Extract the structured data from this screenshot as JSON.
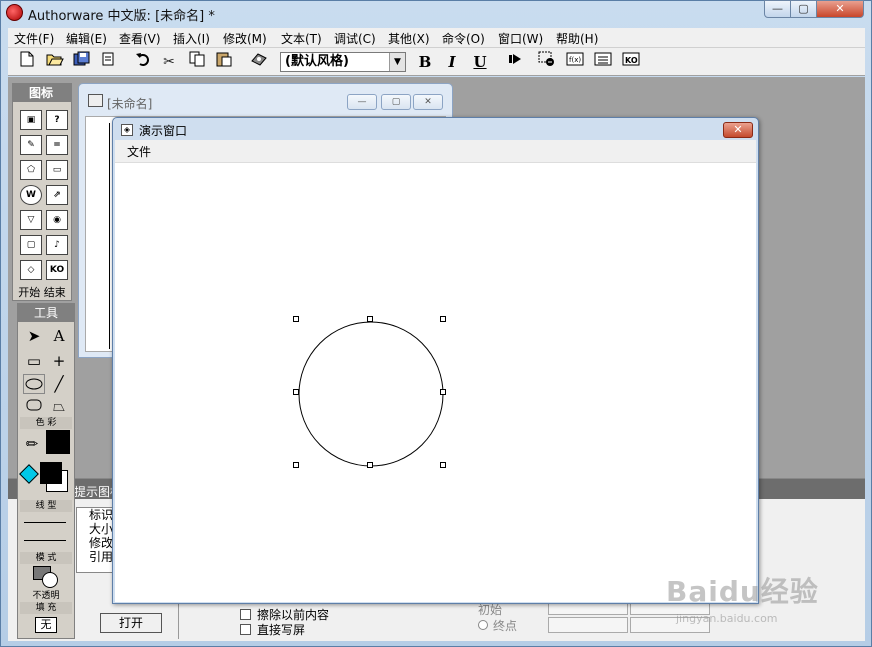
{
  "window": {
    "title": "Authorware 中文版: [未命名] *",
    "min_glyph": "—",
    "max_glyph": "▢",
    "close_glyph": "✕"
  },
  "menubar": {
    "items": [
      "文件(F)",
      "编辑(E)",
      "查看(V)",
      "插入(I)",
      "修改(M)",
      "文本(T)",
      "调试(C)",
      "其他(X)",
      "命令(O)",
      "窗口(W)",
      "帮助(H)"
    ]
  },
  "toolbar": {
    "style_value": "(默认风格)",
    "bold": "B",
    "italic": "I",
    "underline": "U",
    "icons": [
      "new-icon",
      "open-icon",
      "save-all-icon",
      "import-icon",
      "undo-icon",
      "cut-icon",
      "copy-icon",
      "paste-icon",
      "find-icon",
      "run-icon",
      "control-panel-icon",
      "functions-icon",
      "variables-icon",
      "knowledge-objects-icon"
    ]
  },
  "icon_palette": {
    "title": "图标",
    "icons": [
      "display",
      "motion",
      "erase",
      "wait",
      "navigate",
      "framework",
      "decision",
      "interaction",
      "calculation",
      "map",
      "digital-movie",
      "sound",
      "dvd",
      "knowledge-object"
    ],
    "start_end": "开始 结束"
  },
  "tool_palette": {
    "title": "工具",
    "color_label": "色 彩",
    "line_label": "线 型",
    "mode_label": "模 式",
    "mode_value": "不透明",
    "fill_label": "填 充",
    "fill_value": "无"
  },
  "design_window": {
    "title": "[未命名]"
  },
  "properties": {
    "title": "提示图标",
    "labels": [
      "标识",
      "大小",
      "修改",
      "引用"
    ],
    "open_button": "打开",
    "checkbox_erase": "擦除以前内容",
    "checkbox_direct": "直接写屏",
    "radio_initial": "初始",
    "radio_end": "终点"
  },
  "presentation_window": {
    "title": "演示窗口",
    "menu_file": "文件",
    "close_glyph": "✕"
  },
  "watermark": {
    "text": "Baidu经验",
    "url": "jingyan.baidu.com"
  }
}
